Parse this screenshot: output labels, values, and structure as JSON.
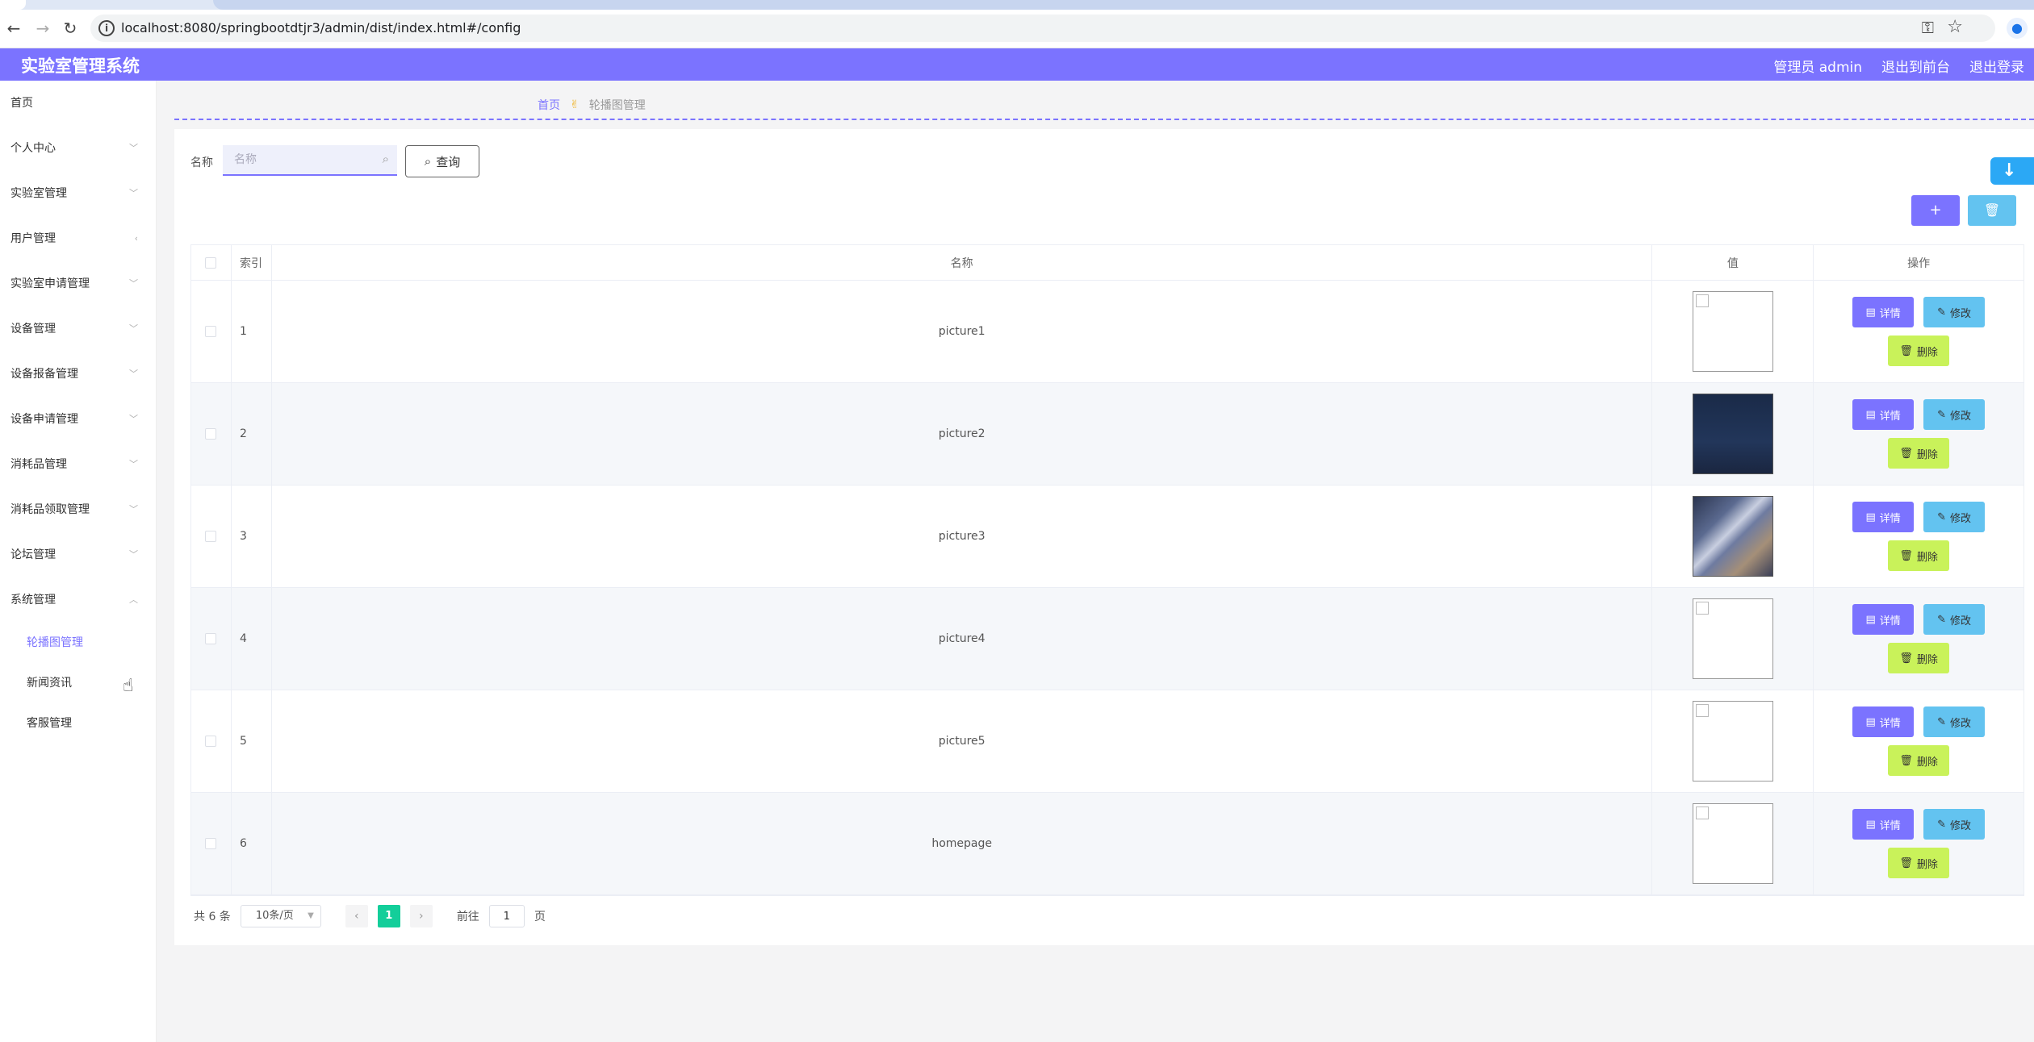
{
  "browser": {
    "url": "localhost:8080/springbootdtjr3/admin/dist/index.html#/config"
  },
  "header": {
    "title": "实验室管理系统",
    "user_label": "管理员 admin",
    "back_front": "退出到前台",
    "logout": "退出登录"
  },
  "sidebar": {
    "home": "首页",
    "items": [
      {
        "label": "个人中心",
        "chevron": "expand"
      },
      {
        "label": "实验室管理",
        "chevron": "expand"
      },
      {
        "label": "用户管理",
        "chevron": "collapsed"
      },
      {
        "label": "实验室申请管理",
        "chevron": "expand"
      },
      {
        "label": "设备管理",
        "chevron": "expand"
      },
      {
        "label": "设备报备管理",
        "chevron": "expand"
      },
      {
        "label": "设备申请管理",
        "chevron": "expand"
      },
      {
        "label": "消耗品管理",
        "chevron": "expand"
      },
      {
        "label": "消耗品领取管理",
        "chevron": "expand"
      },
      {
        "label": "论坛管理",
        "chevron": "expand"
      },
      {
        "label": "系统管理",
        "chevron": "open"
      }
    ],
    "sub_items": [
      {
        "label": "轮播图管理",
        "active": true
      },
      {
        "label": "新闻资讯",
        "active": false
      },
      {
        "label": "客服管理",
        "active": false
      }
    ]
  },
  "breadcrumb": {
    "home": "首页",
    "current": "轮播图管理"
  },
  "search": {
    "label": "名称",
    "placeholder": "名称",
    "value": "",
    "query_label": "查询"
  },
  "toolbar": {
    "add_icon": "plus-icon",
    "delete_icon": "trash-icon"
  },
  "table": {
    "columns": [
      "索引",
      "名称",
      "值",
      "操作"
    ],
    "rows": [
      {
        "index": "1",
        "name": "picture1",
        "image": "broken"
      },
      {
        "index": "2",
        "name": "picture2",
        "image": "dark"
      },
      {
        "index": "3",
        "name": "picture3",
        "image": "city"
      },
      {
        "index": "4",
        "name": "picture4",
        "image": "broken"
      },
      {
        "index": "5",
        "name": "picture5",
        "image": "broken"
      },
      {
        "index": "6",
        "name": "homepage",
        "image": "broken"
      }
    ],
    "actions": {
      "detail": "详情",
      "edit": "修改",
      "delete": "删除"
    }
  },
  "pager": {
    "total": "共 6 条",
    "page_size": "10条/页",
    "current_page": "1",
    "goto_prefix": "前往",
    "goto_value": "1",
    "goto_suffix": "页"
  },
  "colors": {
    "primary": "#7b73ff",
    "info": "#63c3f0",
    "danger_soft": "#c9f25a",
    "pager_active": "#13ce9a"
  }
}
